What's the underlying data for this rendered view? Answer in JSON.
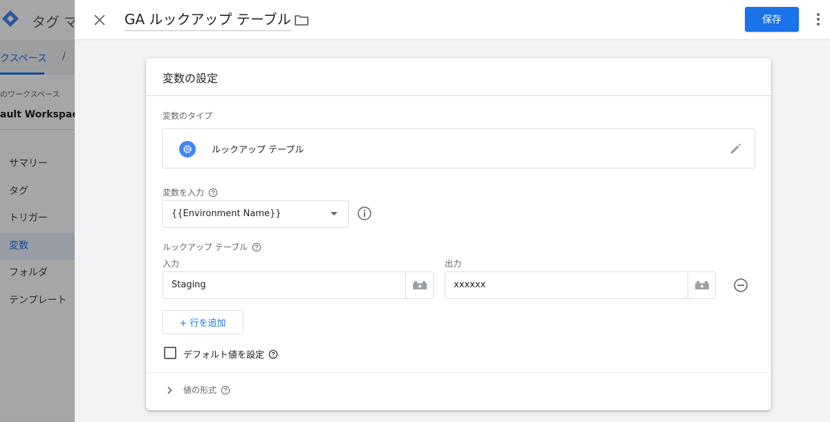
{
  "background": {
    "app_title": "タグ マ",
    "tabs": [
      "クスペース",
      "/"
    ],
    "workspace_label": "のワークスペース",
    "workspace_name": "ault Workspace",
    "nav": [
      "サマリー",
      "タグ",
      "トリガー",
      "変数",
      "フォルダ",
      "テンプレート"
    ],
    "active_nav": "変数"
  },
  "editor": {
    "title": "GA ルックアップ テーブル",
    "save_label": "保存"
  },
  "card": {
    "title": "変数の設定",
    "variable_type_label": "変数のタイプ",
    "variable_type_name": "ルックアップ テーブル",
    "input_variable_label": "変数を入力",
    "input_variable_value": "{{Environment Name}}",
    "lookup_table_label": "ルックアップ テーブル",
    "input_col_label": "入力",
    "output_col_label": "出力",
    "rows": [
      {
        "input": "Staging",
        "output": "xxxxxx"
      }
    ],
    "add_row_label": "+ 行を追加",
    "default_value_label": "デフォルト値を設定",
    "format_label": "値の形式"
  },
  "colors": {
    "accent": "#1a73e8",
    "text": "#202124",
    "muted": "#5f6368"
  }
}
